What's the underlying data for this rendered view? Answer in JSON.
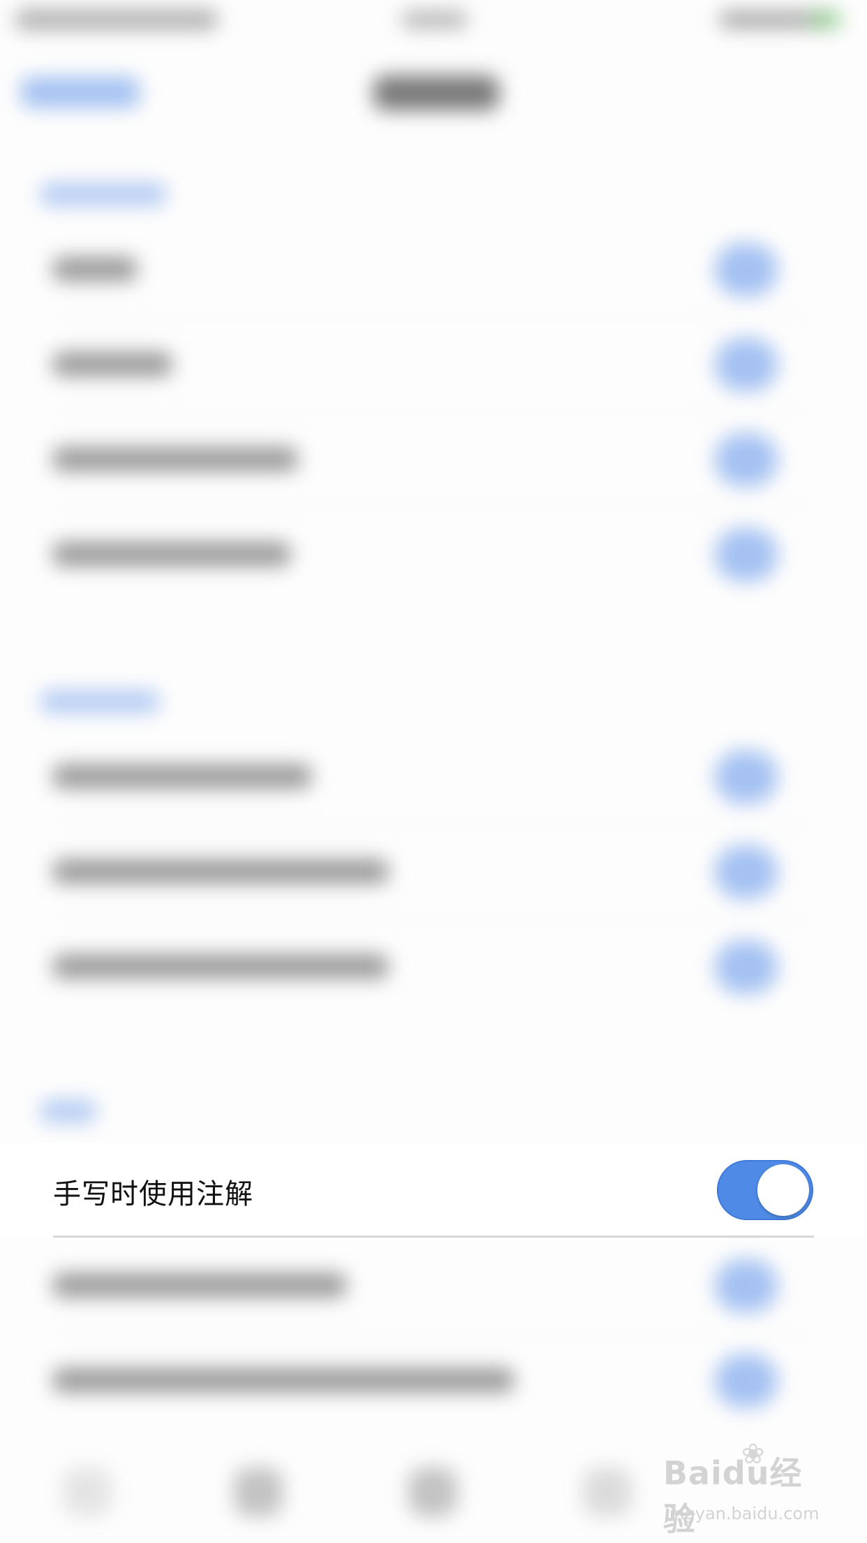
{
  "focus_setting": {
    "label": "手写时使用注解",
    "toggle_on": true
  },
  "colors": {
    "accent": "#4f8ae6",
    "background": "#fdfdfd"
  },
  "watermark": {
    "logo_text": "Baidu经验",
    "url": "jingyan.baidu.com"
  }
}
